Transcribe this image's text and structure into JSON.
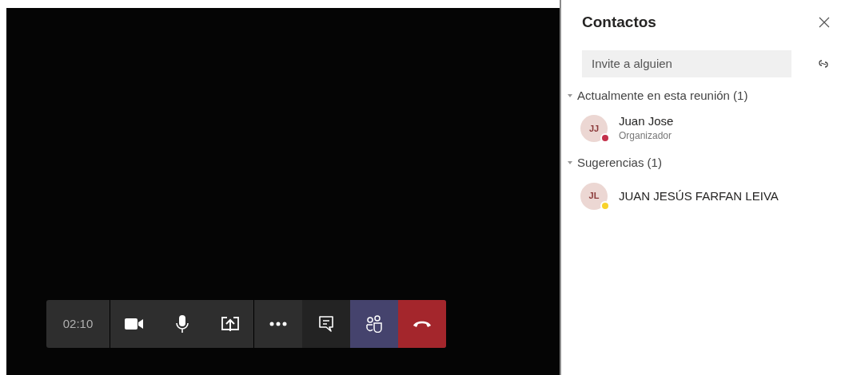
{
  "call_toolbar": {
    "timer": "02:10",
    "buttons": [
      {
        "kind": "video",
        "selected": false
      },
      {
        "kind": "mic",
        "selected": false
      },
      {
        "kind": "share",
        "selected": false
      },
      {
        "kind": "more",
        "selected": false
      },
      {
        "kind": "chat",
        "selected": false
      },
      {
        "kind": "people",
        "selected": true
      },
      {
        "kind": "hangup"
      }
    ]
  },
  "panel": {
    "title": "Contactos",
    "invite": {
      "placeholder": "Invite a alguien"
    },
    "sections": [
      {
        "title": "Actualmente en esta reunión (1)",
        "expanded": true,
        "people": [
          {
            "initials": "JJ",
            "name": "Juan Jose",
            "role": "Organizador",
            "color": "#c4314b"
          }
        ]
      },
      {
        "title": "Sugerencias (1)",
        "expanded": true,
        "people": [
          {
            "initials": "JL",
            "name": "JUAN JESÚS FARFAN LEIVA",
            "color": "#f8d22a"
          }
        ]
      }
    ]
  }
}
